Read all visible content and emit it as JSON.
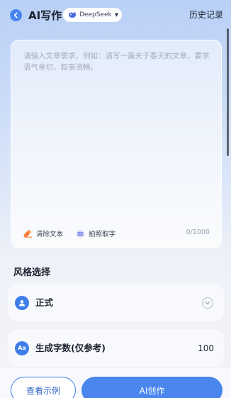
{
  "header": {
    "title": "AI写作",
    "model_selector": {
      "label": "DeepSeek",
      "icon": "deepseek-whale-icon"
    },
    "history_label": "历史记录"
  },
  "editor": {
    "placeholder": "请输入文章需求，例如：请写一篇关于春天的文章，要求语气亲切，叙事流畅。",
    "value": "",
    "tools": [
      {
        "label": "清除文本",
        "icon": "eraser-icon"
      },
      {
        "label": "拍照取字",
        "icon": "camera-icon"
      }
    ],
    "char_count": "0/1000"
  },
  "style_section": {
    "title": "风格选择",
    "selected_style": "正式",
    "icon": "user-icon"
  },
  "word_count": {
    "label": "生成字数(仅参考)",
    "value": "100",
    "icon": "font-icon",
    "icon_text": "Aa"
  },
  "actions": {
    "example_label": "查看示例",
    "create_label": "AI创作"
  },
  "colors": {
    "accent": "#4a86ee",
    "eraser": "#f47a3a"
  }
}
